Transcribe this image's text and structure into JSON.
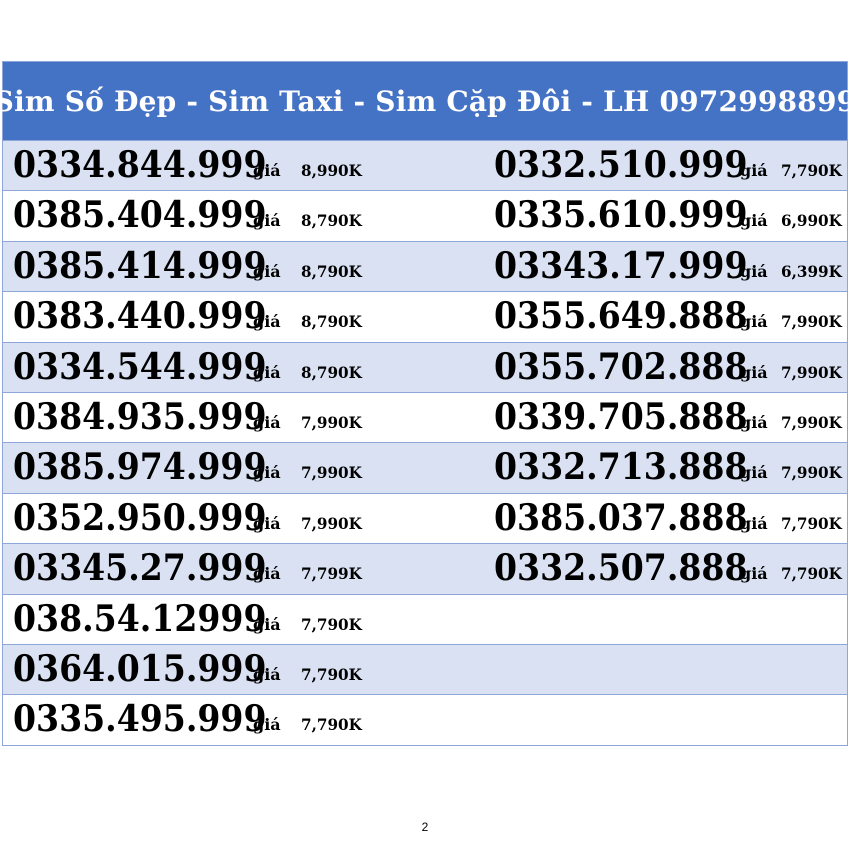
{
  "header": {
    "title": "Sim Số Đẹp - Sim Taxi - Sim Cặp Đôi - LH 0972998899"
  },
  "price_label": "giá",
  "rows": [
    {
      "left": {
        "number": "0334.844.999",
        "price": "8,990K"
      },
      "right": {
        "number": "0332.510.999",
        "price": "7,790K"
      }
    },
    {
      "left": {
        "number": "0385.404.999",
        "price": "8,790K"
      },
      "right": {
        "number": "0335.610.999",
        "price": "6,990K"
      }
    },
    {
      "left": {
        "number": "0385.414.999",
        "price": "8,790K"
      },
      "right": {
        "number": "03343.17.999",
        "price": "6,399K"
      }
    },
    {
      "left": {
        "number": "0383.440.999",
        "price": "8,790K"
      },
      "right": {
        "number": "0355.649.888",
        "price": "7,990K"
      }
    },
    {
      "left": {
        "number": "0334.544.999",
        "price": "8,790K"
      },
      "right": {
        "number": "0355.702.888",
        "price": "7,990K"
      }
    },
    {
      "left": {
        "number": "0384.935.999",
        "price": "7,990K"
      },
      "right": {
        "number": "0339.705.888",
        "price": "7,990K"
      }
    },
    {
      "left": {
        "number": "0385.974.999",
        "price": "7,990K"
      },
      "right": {
        "number": "0332.713.888",
        "price": "7,990K"
      }
    },
    {
      "left": {
        "number": "0352.950.999",
        "price": "7,990K"
      },
      "right": {
        "number": "0385.037.888",
        "price": "7,790K"
      }
    },
    {
      "left": {
        "number": "03345.27.999",
        "price": "7,799K"
      },
      "right": {
        "number": "0332.507.888",
        "price": "7,790K"
      }
    },
    {
      "left": {
        "number": "038.54.12999",
        "price": "7,790K"
      },
      "right": null
    },
    {
      "left": {
        "number": "0364.015.999",
        "price": "7,790K"
      },
      "right": null
    },
    {
      "left": {
        "number": "0335.495.999",
        "price": "7,790K"
      },
      "right": null
    }
  ],
  "colors": {
    "header_bg": "#4472c4",
    "header_text": "#ffffff",
    "row_alt_bg": "#d9e1f2",
    "row_plain_bg": "#ffffff",
    "border": "#8ea6d8"
  },
  "page_number": "2"
}
